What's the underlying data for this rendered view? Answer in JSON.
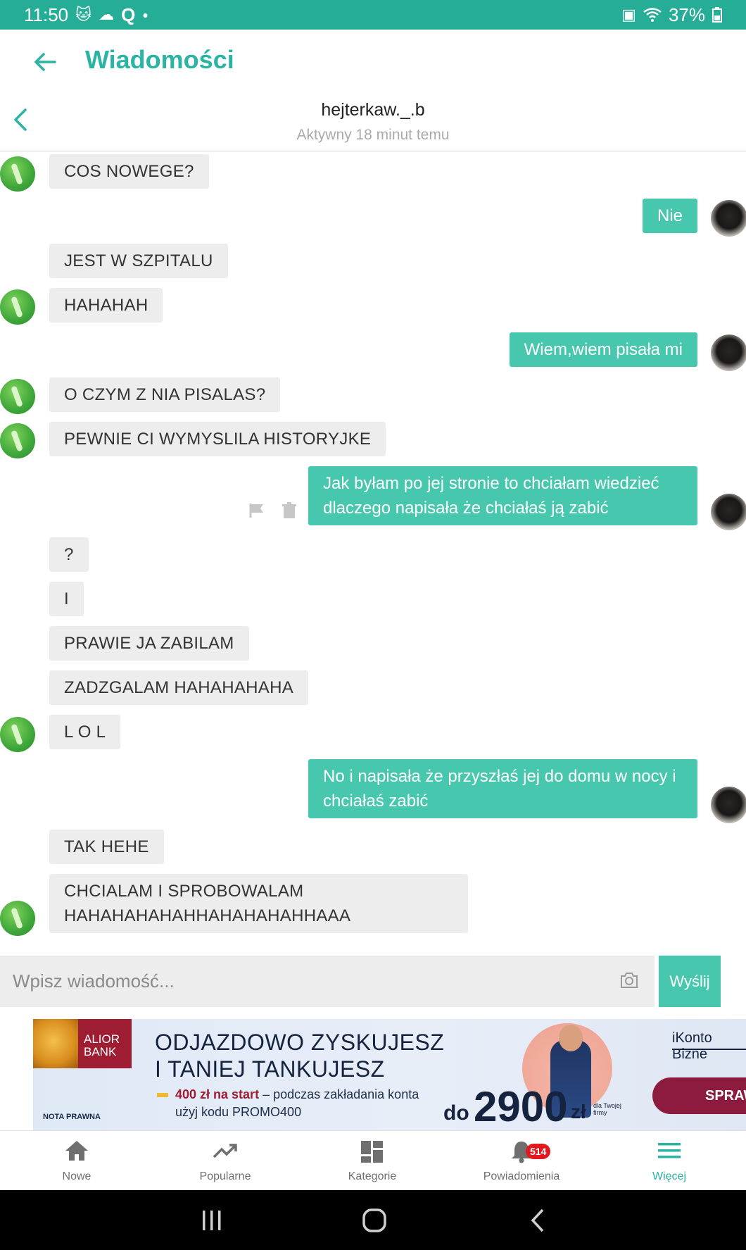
{
  "status_bar": {
    "time": "11:50",
    "battery": "37%",
    "left_icons": [
      "cat-notification-icon",
      "cloud-icon",
      "q-app-icon",
      "dot-icon"
    ],
    "right_icons": [
      "battery-saver-icon",
      "wifi-icon",
      "battery-icon"
    ]
  },
  "app_bar": {
    "title": "Wiadomości"
  },
  "chat_header": {
    "contact_name": "hejterkaw._.b",
    "contact_status": "Aktywny 18 minut temu"
  },
  "messages": [
    {
      "dir": "in",
      "text": "COS NOWEGE?",
      "avatar": true
    },
    {
      "dir": "out",
      "text": "Nie",
      "avatar": true
    },
    {
      "dir": "in",
      "text": "JEST W SZPITALU",
      "avatar": false
    },
    {
      "dir": "in",
      "text": "HAHAHAH",
      "avatar": true
    },
    {
      "dir": "out",
      "text": "Wiem,wiem pisała mi",
      "avatar": true
    },
    {
      "dir": "in",
      "text": "O CZYM Z NIA PISALAS?",
      "avatar": true
    },
    {
      "dir": "in",
      "text": "PEWNIE CI WYMYSLILA HISTORYJKE",
      "avatar": true
    },
    {
      "dir": "out",
      "text": "Jak byłam po jej stronie to chciałam wiedzieć dlaczego napisała że chciałaś ją zabić",
      "avatar": true,
      "actions": [
        "flag-icon",
        "trash-icon"
      ]
    },
    {
      "dir": "in",
      "text": "?",
      "avatar": false
    },
    {
      "dir": "in",
      "text": "I",
      "avatar": false
    },
    {
      "dir": "in",
      "text": "PRAWIE JA ZABILAM",
      "avatar": false
    },
    {
      "dir": "in",
      "text": "ZADZGALAM HAHAHAHAHA",
      "avatar": false
    },
    {
      "dir": "in",
      "text": "L O L",
      "avatar": true
    },
    {
      "dir": "out",
      "text": "No i napisała że przyszłaś jej do domu w nocy i chciałaś zabić",
      "avatar": true
    },
    {
      "dir": "in",
      "text": "TAK HEHE",
      "avatar": false
    },
    {
      "dir": "in",
      "text": "CHCIALAM I SPROBOWALAM HAHAHAHAHAHHAHAHAHAHHAAA",
      "avatar": true
    }
  ],
  "composer": {
    "placeholder": "Wpisz wiadomość...",
    "send_label": "Wyślij"
  },
  "ad": {
    "bank_name": "ALIOR BANK",
    "legal": "NOTA PRAWNA",
    "headline_line1": "ODJAZDOWO ZYSKUJESZ",
    "headline_line2": "I TANIEJ TANKUJESZ",
    "sub_bold": "400 zł na start",
    "sub_rest": " – podczas zakładania konta",
    "sub_line2": "użyj kodu PROMO400",
    "amount_prefix": "do",
    "amount": "2900",
    "currency": "zł",
    "amount_note": "dla Twojej firmy",
    "brand": "iKonto Bizne",
    "cta": "SPRAW"
  },
  "bottom_nav": [
    {
      "label": "Nowe",
      "icon": "home-icon",
      "active": false
    },
    {
      "label": "Popularne",
      "icon": "trending-icon",
      "active": false
    },
    {
      "label": "Kategorie",
      "icon": "grid-icon",
      "active": false
    },
    {
      "label": "Powiadomienia",
      "icon": "bell-icon",
      "active": false,
      "badge": "514"
    },
    {
      "label": "Więcej",
      "icon": "menu-icon",
      "active": true
    }
  ],
  "colors": {
    "accent": "#2bb3a3",
    "status_bar": "#26ad98",
    "outgoing_bubble": "#47c8ae",
    "incoming_bubble": "#ededed",
    "badge": "#e0191f"
  }
}
